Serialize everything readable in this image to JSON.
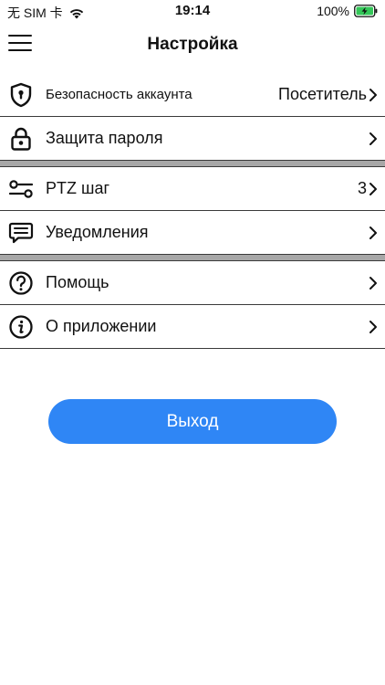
{
  "status_bar": {
    "carrier": "无 SIM 卡",
    "time": "19:14",
    "battery_percent": "100%"
  },
  "header": {
    "title": "Настройка"
  },
  "settings": {
    "account_security": {
      "label": "Безопасность аккаунта",
      "value": "Посетитель",
      "icon": "shield-icon"
    },
    "password_protection": {
      "label": "Защита пароля",
      "icon": "lock-icon"
    },
    "ptz_step": {
      "label": "PTZ шаг",
      "value": "3",
      "icon": "sliders-icon"
    },
    "notifications": {
      "label": "Уведомления",
      "icon": "message-icon"
    },
    "help": {
      "label": "Помощь",
      "icon": "question-icon"
    },
    "about": {
      "label": "О приложении",
      "icon": "info-icon"
    }
  },
  "logout": {
    "label": "Выход",
    "color": "#2f86f5"
  }
}
